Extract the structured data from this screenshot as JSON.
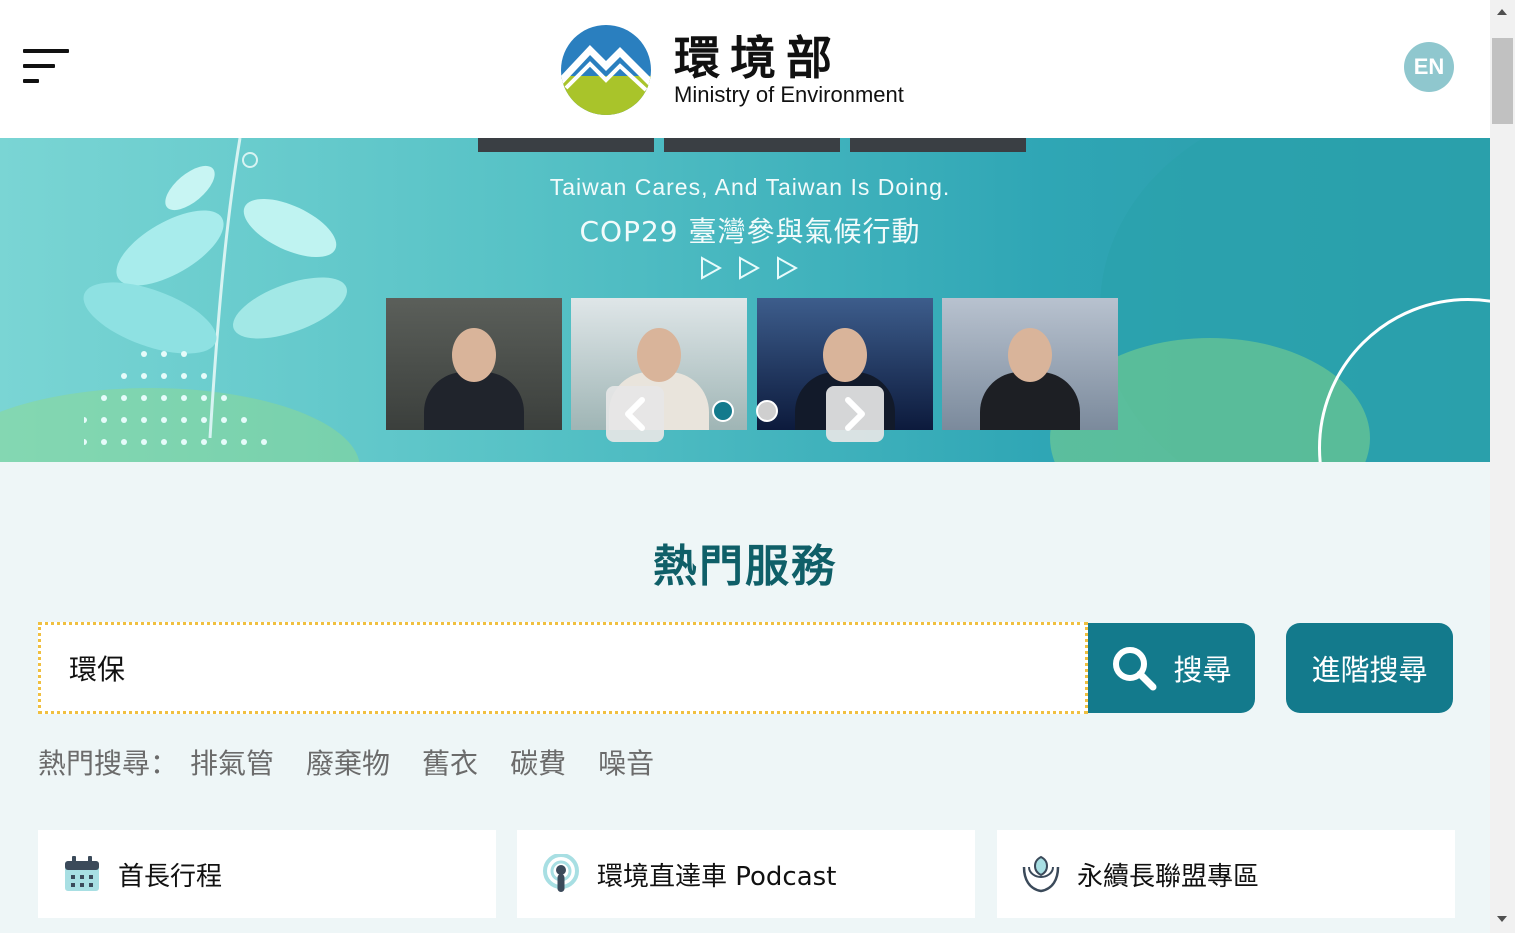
{
  "header": {
    "logo_zh": "環境部",
    "logo_en": "Ministry of Environment",
    "lang_button": "EN",
    "menu_icon": "hamburger-menu-icon"
  },
  "banner": {
    "tagline_en": "Taiwan Cares, And Taiwan Is Doing.",
    "tagline_zh": "COP29 臺灣參與氣候行動",
    "active_slide": 1,
    "slide_count": 2,
    "prev_icon": "chevron-left-icon",
    "next_icon": "chevron-right-icon"
  },
  "services": {
    "title": "熱門服務",
    "search": {
      "value": "環保",
      "button_label": "搜尋",
      "advanced_label": "進階搜尋",
      "icon": "search-icon"
    },
    "hot_search_label": "熱門搜尋：",
    "hot_tags": [
      "排氣管",
      "廢棄物",
      "舊衣",
      "碳費",
      "噪音"
    ],
    "quick_links": [
      {
        "label": "首長行程",
        "icon": "calendar-icon"
      },
      {
        "label": "環境直達車 Podcast",
        "icon": "podcast-icon"
      },
      {
        "label": "永續長聯盟專區",
        "icon": "leaf-hands-icon"
      }
    ]
  },
  "colors": {
    "brand_teal": "#137a8c",
    "title_teal": "#0f5f68",
    "services_bg": "#eef6f7",
    "search_border": "#f0c040"
  }
}
